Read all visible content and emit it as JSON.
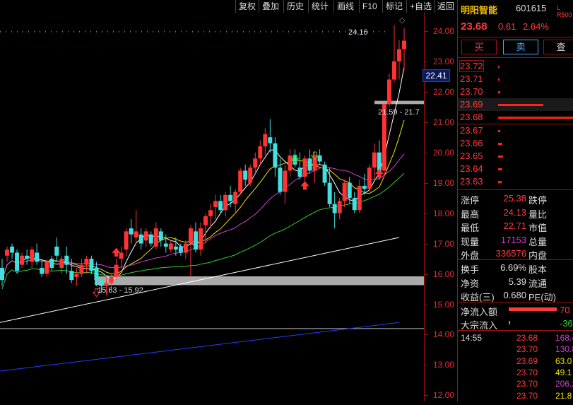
{
  "toolbar": {
    "items": [
      "复权",
      "叠加",
      "历史",
      "统计",
      "画线",
      "F10",
      "标记",
      "+自选",
      "返回"
    ]
  },
  "price_axis": {
    "ticks": [
      "24.00",
      "23.00",
      "22.00",
      "21.00",
      "20.00",
      "19.00",
      "18.00",
      "17.00",
      "16.00",
      "15.00",
      "14.00",
      "13.00",
      "12.00"
    ],
    "cursor_value": "22.41"
  },
  "chart": {
    "high_label": "24.16",
    "range_label_1": "21.59 - 21.7",
    "range_label_2": "15.63 - 15.92",
    "diamond": "◇"
  },
  "chart_data": {
    "type": "candlestick",
    "ylim": [
      11.8,
      24.6
    ],
    "candles": [
      [
        16.2,
        16.5,
        15.6,
        15.8
      ],
      [
        16.6,
        16.9,
        16.4,
        16.8
      ],
      [
        16.9,
        17.0,
        16.5,
        16.7
      ],
      [
        16.7,
        16.8,
        16.0,
        16.1
      ],
      [
        16.3,
        16.7,
        16.2,
        16.6
      ],
      [
        16.6,
        16.8,
        16.3,
        16.5
      ],
      [
        16.4,
        16.9,
        16.2,
        16.8
      ],
      [
        16.7,
        17.0,
        16.3,
        16.4
      ],
      [
        16.2,
        16.5,
        15.9,
        16.0
      ],
      [
        16.0,
        16.5,
        15.9,
        16.4
      ],
      [
        16.5,
        16.6,
        16.1,
        16.2
      ],
      [
        16.9,
        17.2,
        16.4,
        16.6
      ],
      [
        16.2,
        16.6,
        16.0,
        16.5
      ],
      [
        16.6,
        16.9,
        16.0,
        16.3
      ],
      [
        16.1,
        16.5,
        15.7,
        15.8
      ],
      [
        15.9,
        16.2,
        15.6,
        16.0
      ],
      [
        16.0,
        16.5,
        15.9,
        16.3
      ],
      [
        16.3,
        16.6,
        16.0,
        16.5
      ],
      [
        16.5,
        16.6,
        16.0,
        16.1
      ],
      [
        16.2,
        16.4,
        15.6,
        15.8
      ],
      [
        15.8,
        15.9,
        15.4,
        15.6
      ],
      [
        15.6,
        15.9,
        15.3,
        15.7
      ],
      [
        15.7,
        16.0,
        15.5,
        15.9
      ],
      [
        15.9,
        16.5,
        15.8,
        16.3
      ],
      [
        16.5,
        16.9,
        16.2,
        16.7
      ],
      [
        16.8,
        17.5,
        16.6,
        17.4
      ],
      [
        17.5,
        17.8,
        17.0,
        17.3
      ],
      [
        17.2,
        18.1,
        17.0,
        17.4
      ],
      [
        17.3,
        17.5,
        16.8,
        17.0
      ],
      [
        17.1,
        17.5,
        16.9,
        17.4
      ],
      [
        17.3,
        17.4,
        16.9,
        17.0
      ],
      [
        16.9,
        17.7,
        16.8,
        17.5
      ],
      [
        17.4,
        17.5,
        16.9,
        17.1
      ],
      [
        17.0,
        17.3,
        16.7,
        16.9
      ],
      [
        16.8,
        17.1,
        16.7,
        17.0
      ],
      [
        16.9,
        17.2,
        16.6,
        16.8
      ],
      [
        16.9,
        17.0,
        16.6,
        16.7
      ],
      [
        16.7,
        17.1,
        16.5,
        17.0
      ],
      [
        17.0,
        17.6,
        15.9,
        17.5
      ],
      [
        17.4,
        17.7,
        16.7,
        16.8
      ],
      [
        16.8,
        17.7,
        16.6,
        17.5
      ],
      [
        17.6,
        18.0,
        17.0,
        17.9
      ],
      [
        17.9,
        18.3,
        17.5,
        18.1
      ],
      [
        18.2,
        18.6,
        17.8,
        18.4
      ],
      [
        18.4,
        18.6,
        18.0,
        18.1
      ],
      [
        18.1,
        18.7,
        17.9,
        18.6
      ],
      [
        18.6,
        18.9,
        18.2,
        18.4
      ],
      [
        18.3,
        18.8,
        18.0,
        18.7
      ],
      [
        18.7,
        19.5,
        18.6,
        19.4
      ],
      [
        19.4,
        19.6,
        18.9,
        19.1
      ],
      [
        19.0,
        19.6,
        18.9,
        19.5
      ],
      [
        19.5,
        20.0,
        19.3,
        19.8
      ],
      [
        19.8,
        20.4,
        19.6,
        20.2
      ],
      [
        20.2,
        20.8,
        19.9,
        20.6
      ],
      [
        20.5,
        21.1,
        20.0,
        20.3
      ],
      [
        20.3,
        20.5,
        19.2,
        19.5
      ],
      [
        19.5,
        19.8,
        18.6,
        18.7
      ],
      [
        18.7,
        19.6,
        18.3,
        19.4
      ],
      [
        19.4,
        20.1,
        19.2,
        19.9
      ],
      [
        19.9,
        20.1,
        19.5,
        19.6
      ],
      [
        19.5,
        20.0,
        19.1,
        19.2
      ],
      [
        19.2,
        19.9,
        18.9,
        19.8
      ],
      [
        19.8,
        20.1,
        19.3,
        19.4
      ],
      [
        19.4,
        20.0,
        19.0,
        19.9
      ],
      [
        19.9,
        20.1,
        19.6,
        19.7
      ],
      [
        19.6,
        19.7,
        18.9,
        19.0
      ],
      [
        19.0,
        19.5,
        18.2,
        18.3
      ],
      [
        18.3,
        18.7,
        17.5,
        18.0
      ],
      [
        18.0,
        18.5,
        17.8,
        18.4
      ],
      [
        18.4,
        19.1,
        18.2,
        19.0
      ],
      [
        19.0,
        19.2,
        18.3,
        18.5
      ],
      [
        18.5,
        18.7,
        18.0,
        18.1
      ],
      [
        18.1,
        19.1,
        18.0,
        18.9
      ],
      [
        18.9,
        19.3,
        18.6,
        18.8
      ],
      [
        18.8,
        19.6,
        18.7,
        19.5
      ],
      [
        19.5,
        20.3,
        19.1,
        20.0
      ],
      [
        20.0,
        20.4,
        19.1,
        19.4
      ],
      [
        19.4,
        21.6,
        19.2,
        21.6
      ],
      [
        21.6,
        22.6,
        21.5,
        22.4
      ],
      [
        22.4,
        24.2,
        22.3,
        23.0
      ],
      [
        23.0,
        23.7,
        22.4,
        23.4
      ],
      [
        23.4,
        24.1,
        22.7,
        23.68
      ]
    ],
    "ma_colors": [
      "#ffffff",
      "#f0e000",
      "#d040d0",
      "#30d030",
      "#ffffff",
      "#2040ff"
    ],
    "price_axis_color": "#e03030"
  },
  "quote": {
    "name": "明阳智能",
    "code": "601615",
    "tag": "L R500",
    "price": "23.68",
    "change": "0.61",
    "pct": "2.64%",
    "buy": "买",
    "sell": "卖",
    "misc": "查"
  },
  "asks": [
    {
      "price": "23.72",
      "bar": 0.02
    },
    {
      "price": "23.71",
      "bar": 0.02
    },
    {
      "price": "23.70",
      "bar": 0.03
    },
    {
      "price": "23.69",
      "bar": 0.6
    },
    {
      "price": "23.68",
      "bar": 1.0
    }
  ],
  "bids": [
    {
      "price": "23.67",
      "bar": 0.03
    },
    {
      "price": "23.66",
      "bar": 0.06
    },
    {
      "price": "23.65",
      "bar": 0.07
    },
    {
      "price": "23.64",
      "bar": 0.06
    },
    {
      "price": "23.63",
      "bar": 0.05
    }
  ],
  "stats": [
    {
      "l": "涨停",
      "v": "25.38",
      "vc": "#ff3b3b",
      "l2": "跌停",
      "v2": ""
    },
    {
      "l": "最高",
      "v": "24.13",
      "vc": "#ff3b3b",
      "l2": "量比",
      "v2": ""
    },
    {
      "l": "最低",
      "v": "22.71",
      "vc": "#ff3b3b",
      "l2": "市值",
      "v2": ""
    },
    {
      "l": "现量",
      "v": "17153",
      "vc": "#d040d0",
      "l2": "总量",
      "v2": ""
    },
    {
      "l": "外盘",
      "v": "336576",
      "vc": "#ff3b3b",
      "l2": "内盘",
      "v2": ""
    }
  ],
  "stats2": [
    {
      "l": "换手",
      "v": "6.69%",
      "vc": "#ddd",
      "l2": "股本",
      "v2": ""
    },
    {
      "l": "净资",
      "v": "5.39",
      "vc": "#ddd",
      "l2": "流通",
      "v2": ""
    },
    {
      "l": "收益(三)",
      "v": "0.680",
      "vc": "#ddd",
      "l2": "PE(动)",
      "v2": ""
    }
  ],
  "flows": [
    {
      "l": "净流入额",
      "v": "70",
      "vc": "#ff3b3b",
      "bar": 0.4
    },
    {
      "l": "大宗流入",
      "v": "-36",
      "vc": "#30d030",
      "bar": 0.0
    }
  ],
  "trades": {
    "time": "14:55",
    "rows": [
      {
        "price": "23.68",
        "vol": "168.4",
        "vc": "#d040d0"
      },
      {
        "price": "23.70",
        "vol": "130.8",
        "vc": "#d040d0"
      },
      {
        "price": "23.69",
        "vol": "63.0",
        "vc": "#f0e000"
      },
      {
        "price": "23.70",
        "vol": "49.1",
        "vc": "#f0e000"
      },
      {
        "price": "23.70",
        "vol": "206.2",
        "vc": "#d040d0"
      },
      {
        "price": "23.70",
        "vol": "21.8",
        "vc": "#f0e000"
      }
    ]
  }
}
